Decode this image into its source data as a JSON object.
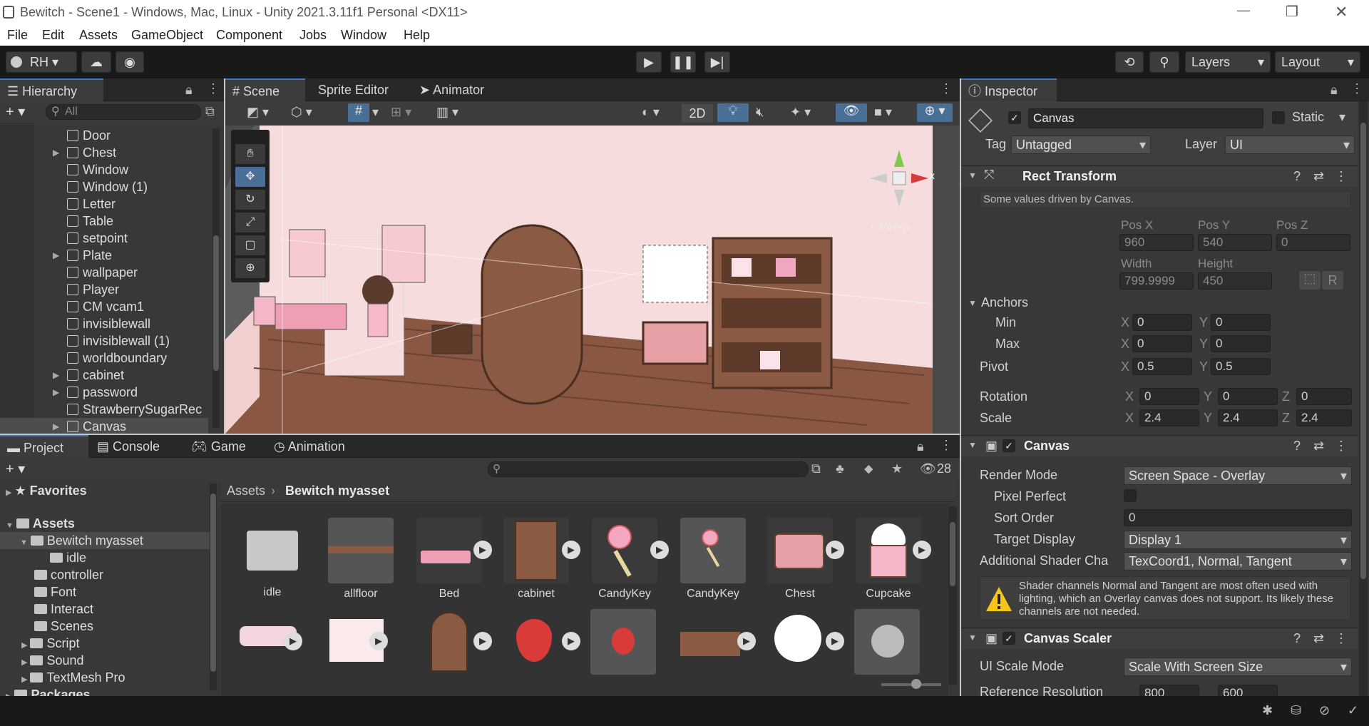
{
  "window": {
    "title": "Bewitch - Scene1 - Windows, Mac, Linux - Unity 2021.3.11f1 Personal <DX11>",
    "controls": {
      "minimize": "—",
      "maximize": "❐",
      "close": "✕"
    }
  },
  "menu": [
    "File",
    "Edit",
    "Assets",
    "GameObject",
    "Component",
    "Jobs",
    "Window",
    "Help"
  ],
  "toolbar": {
    "account": "RH",
    "layers": "Layers",
    "layout": "Layout"
  },
  "hierarchy": {
    "tab": "Hierarchy",
    "search_placeholder": "All",
    "items": [
      {
        "name": "Door",
        "expandable": false
      },
      {
        "name": "Chest",
        "expandable": true
      },
      {
        "name": "Window",
        "expandable": false
      },
      {
        "name": "Window (1)",
        "expandable": false
      },
      {
        "name": "Letter",
        "expandable": false
      },
      {
        "name": "Table",
        "expandable": false
      },
      {
        "name": "setpoint",
        "expandable": false
      },
      {
        "name": "Plate",
        "expandable": true
      },
      {
        "name": "wallpaper",
        "expandable": false
      },
      {
        "name": "Player",
        "expandable": false
      },
      {
        "name": "CM vcam1",
        "expandable": false
      },
      {
        "name": "invisiblewall",
        "expandable": false
      },
      {
        "name": "invisiblewall (1)",
        "expandable": false
      },
      {
        "name": "worldboundary",
        "expandable": false
      },
      {
        "name": "cabinet",
        "expandable": true
      },
      {
        "name": "password",
        "expandable": true
      },
      {
        "name": "StrawberrySugarRec",
        "expandable": false
      },
      {
        "name": "Canvas",
        "expandable": true
      }
    ]
  },
  "scene": {
    "tabs": [
      "Scene",
      "Sprite Editor",
      "Animator"
    ],
    "mode_2d": "2D",
    "persp": "< Persp",
    "gizmo_x": "x"
  },
  "inspector": {
    "tab": "Inspector",
    "object_name": "Canvas",
    "static_label": "Static",
    "tag_label": "Tag",
    "tag_value": "Untagged",
    "layer_label": "Layer",
    "layer_value": "UI",
    "rect": {
      "title": "Rect Transform",
      "note": "Some values driven by Canvas.",
      "posx_label": "Pos X",
      "posy_label": "Pos Y",
      "posz_label": "Pos Z",
      "posx": "960",
      "posy": "540",
      "posz": "0",
      "width_label": "Width",
      "height_label": "Height",
      "width": "799.9999",
      "height": "450",
      "r_button": "R",
      "anchors": "Anchors",
      "min": "Min",
      "max": "Max",
      "min_x": "0",
      "min_y": "0",
      "max_x": "0",
      "max_y": "0",
      "pivot": "Pivot",
      "pivot_x": "0.5",
      "pivot_y": "0.5",
      "rotation": "Rotation",
      "rot_x": "0",
      "rot_y": "0",
      "rot_z": "0",
      "scale": "Scale",
      "scale_x": "2.4",
      "scale_y": "2.4",
      "scale_z": "2.4",
      "x": "X",
      "y": "Y",
      "z": "Z"
    },
    "canvas": {
      "title": "Canvas",
      "render_mode_label": "Render Mode",
      "render_mode": "Screen Space - Overlay",
      "pixel_perfect_label": "Pixel Perfect",
      "sort_order_label": "Sort Order",
      "sort_order": "0",
      "target_display_label": "Target Display",
      "target_display": "Display 1",
      "shader_label": "Additional Shader Cha",
      "shader_value": "TexCoord1, Normal, Tangent",
      "warning": "Shader channels Normal and Tangent are most often used with lighting, which an Overlay canvas does not support. Its likely these channels are not needed."
    },
    "scaler": {
      "title": "Canvas Scaler",
      "mode_label": "UI Scale Mode",
      "mode": "Scale With Screen Size",
      "ref_label": "Reference Resolution",
      "ref_x": "800",
      "ref_y": "600"
    }
  },
  "project": {
    "tabs": [
      "Project",
      "Console",
      "Game",
      "Animation"
    ],
    "hidden_count": "28",
    "favorites": "Favorites",
    "assets": "Assets",
    "tree": [
      "Bewitch myasset",
      "idle",
      "controller",
      "Font",
      "Interact",
      "Scenes",
      "Script",
      "Sound",
      "TextMesh Pro"
    ],
    "packages": "Packages",
    "breadcrumb_root": "Assets",
    "breadcrumb_current": "Bewitch myasset",
    "assets_row1": [
      "idle",
      "allfloor",
      "Bed",
      "cabinet",
      "CandyKey",
      "CandyKey",
      "Chest",
      "Cupcake"
    ]
  },
  "colors": {
    "accent": "#3a79bb",
    "panel": "#383838",
    "dark": "#191919",
    "wall": "#f6dcdc",
    "floor": "#8b5a43"
  }
}
